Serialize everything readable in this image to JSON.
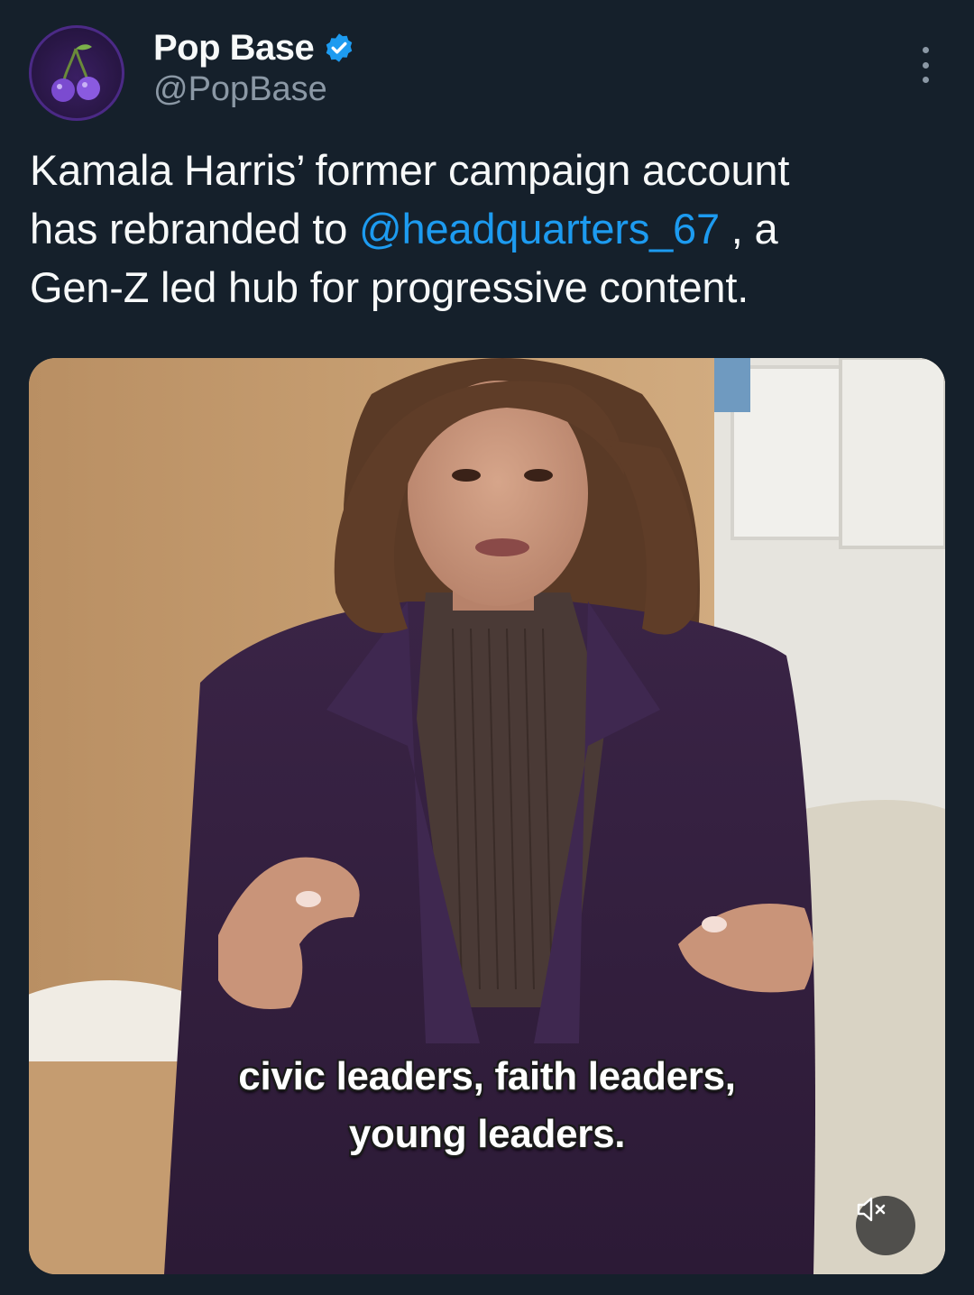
{
  "author": {
    "display_name": "Pop Base",
    "handle": "@PopBase",
    "verified": true,
    "avatar_icon": "cherry-icon"
  },
  "tweet": {
    "text_line1": "Kamala Harris’ former campaign account",
    "text_line2_before": "has rebranded to ",
    "mention": "@headquarters_67",
    "text_line2_after": " , a",
    "text_line3": "Gen-Z led hub for progressive content."
  },
  "media": {
    "type": "video",
    "caption_line1": "civic leaders, faith leaders,",
    "caption_line2": "young leaders.",
    "muted": true
  },
  "colors": {
    "background": "#15202b",
    "link": "#1d9bf0",
    "secondary_text": "#8b98a5"
  }
}
